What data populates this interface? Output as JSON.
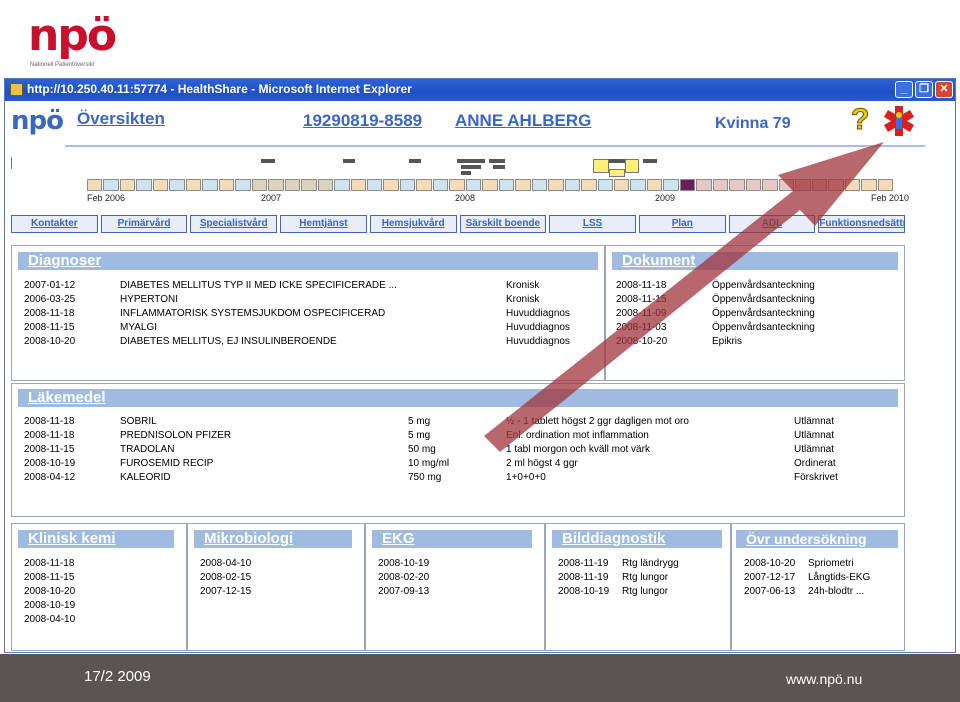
{
  "slide": {
    "logo_text": "npö",
    "logo_subtitle": "Nationell Patientöversikt",
    "footer_date": "17/2 2009",
    "footer_url": "www.npö.nu"
  },
  "window": {
    "title": "http://10.250.40.11:57774 - HealthShare - Microsoft Internet Explorer",
    "min_label": "_",
    "max_label": "❐",
    "close_label": "✕"
  },
  "header": {
    "logo_text": "npö",
    "page_title": "Översikten",
    "personal_id": "19290819-8589",
    "patient_name": "ANNE AHLBERG",
    "sex_age": "Kvinna 79",
    "help_label": "?"
  },
  "timeline": {
    "labels": [
      "Feb 2006",
      "2007",
      "2008",
      "2009",
      "Feb 2010"
    ]
  },
  "tabs": [
    "Kontakter",
    "Primärvård",
    "Specialistvård",
    "Hemtjänst",
    "Hemsjukvård",
    "Särskilt boende",
    "LSS",
    "Plan",
    "ADL",
    "Funktionsnedsättning"
  ],
  "diagnoser": {
    "title": "Diagnoser",
    "rows": [
      {
        "date": "2007-01-12",
        "text": "DIABETES MELLITUS TYP II MED ICKE SPECIFICERADE ...",
        "type": "Kronisk"
      },
      {
        "date": "2006-03-25",
        "text": "HYPERTONI",
        "type": "Kronisk"
      },
      {
        "date": "2008-11-18",
        "text": "INFLAMMATORISK SYSTEMSJUKDOM OSPECIFICERAD",
        "type": "Huvuddiagnos"
      },
      {
        "date": "2008-11-15",
        "text": "MYALGI",
        "type": "Huvuddiagnos"
      },
      {
        "date": "2008-10-20",
        "text": "DIABETES MELLITUS, EJ INSULINBEROENDE",
        "type": "Huvuddiagnos"
      }
    ]
  },
  "dokument": {
    "title": "Dokument",
    "rows": [
      {
        "date": "2008-11-18",
        "text": "Öppenvårdsanteckning"
      },
      {
        "date": "2008-11-15",
        "text": "Öppenvårdsanteckning"
      },
      {
        "date": "2008-11-09",
        "text": "Öppenvårdsanteckning"
      },
      {
        "date": "2008-11-03",
        "text": "Öppenvårdsanteckning"
      },
      {
        "date": "2008-10-20",
        "text": "Epikris"
      }
    ]
  },
  "lakemedel": {
    "title": "Läkemedel",
    "rows": [
      {
        "date": "2008-11-18",
        "name": "SOBRIL",
        "dose": "5 mg",
        "instr": "½ - 1 tablett högst 2 ggr dagligen mot oro",
        "status": "Utlämnat"
      },
      {
        "date": "2008-11-18",
        "name": "PREDNISOLON PFIZER",
        "dose": "5 mg",
        "instr": "Enl. ordination mot inflammation",
        "status": "Utlämnat"
      },
      {
        "date": "2008-11-15",
        "name": "TRADOLAN",
        "dose": "50 mg",
        "instr": "1 tabl morgon och kväll mot värk",
        "status": "Utlämnat"
      },
      {
        "date": "2008-10-19",
        "name": "FUROSEMID RECIP",
        "dose": "10 mg/ml",
        "instr": "2 ml högst 4 ggr",
        "status": "Ordinerat"
      },
      {
        "date": "2008-04-12",
        "name": "KALEORID",
        "dose": "750 mg",
        "instr": "1+0+0+0",
        "status": "Förskrivet"
      }
    ]
  },
  "klinisk_kemi": {
    "title": "Klinisk kemi",
    "rows": [
      "2008-11-18",
      "2008-11-15",
      "2008-10-20",
      "2008-10-19",
      "2008-04-10"
    ]
  },
  "mikrobiologi": {
    "title": "Mikrobiologi",
    "rows": [
      "2008-04-10",
      "2008-02-15",
      "2007-12-15"
    ]
  },
  "ekg": {
    "title": "EKG",
    "rows": [
      "2008-10-19",
      "2008-02-20",
      "2007-09-13"
    ]
  },
  "bilddiagnostik": {
    "title": "Bilddiagnostik",
    "rows": [
      {
        "date": "2008-11-19",
        "text": "Rtg ländrygg"
      },
      {
        "date": "2008-11-19",
        "text": "Rtg lungor"
      },
      {
        "date": "2008-10-19",
        "text": "Rtg lungor"
      }
    ]
  },
  "ovr_undersokning": {
    "title": "Övr undersökning",
    "rows": [
      {
        "date": "2008-10-20",
        "text": "Spriometri"
      },
      {
        "date": "2007-12-17",
        "text": "Långtids-EKG"
      },
      {
        "date": "2007-06-13",
        "text": "24h-blodtr ..."
      }
    ]
  },
  "colors": {
    "brand_red": "#c8102e",
    "link_blue": "#3a66c4",
    "panel_header": "#9fbbe2",
    "arrow": "#a0343c"
  }
}
